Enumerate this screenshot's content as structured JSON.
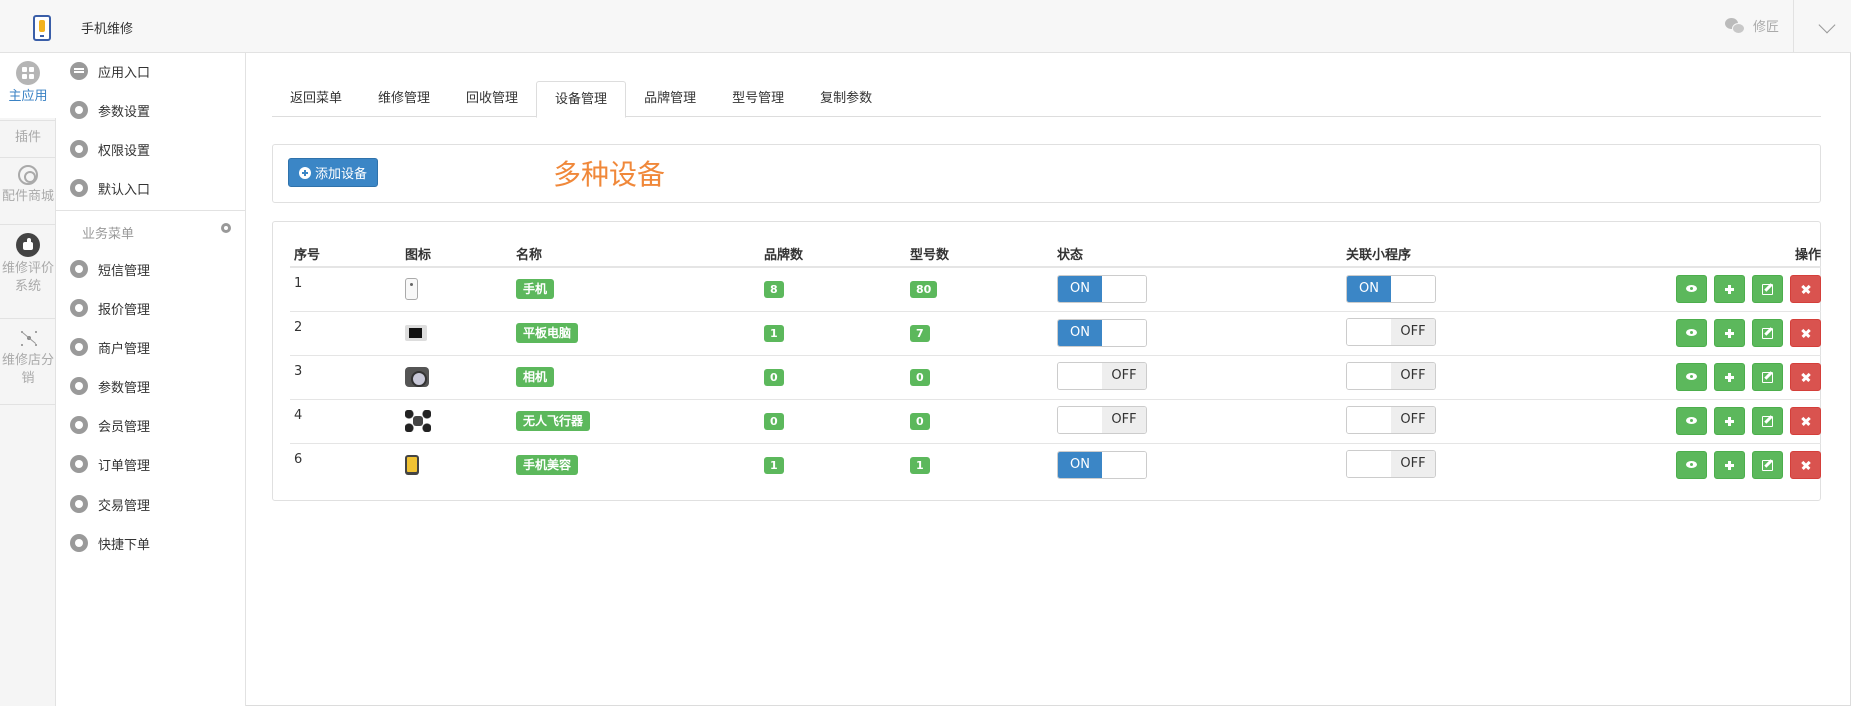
{
  "header": {
    "app_title": "手机维修",
    "user_name": "修匠"
  },
  "rail": {
    "items": [
      {
        "label": "主应用",
        "active": true
      },
      {
        "label": "插件"
      },
      {
        "label": "配件商城"
      },
      {
        "label": "维修评价系统"
      },
      {
        "label": "维修店分销"
      }
    ]
  },
  "menu": {
    "top_items": [
      "应用入口",
      "参数设置",
      "权限设置",
      "默认入口"
    ],
    "group_title": "业务菜单",
    "business_items": [
      "短信管理",
      "报价管理",
      "商户管理",
      "参数管理",
      "会员管理",
      "订单管理",
      "交易管理",
      "快捷下单"
    ]
  },
  "tabs": [
    {
      "label": "返回菜单"
    },
    {
      "label": "维修管理"
    },
    {
      "label": "回收管理"
    },
    {
      "label": "设备管理",
      "active": true
    },
    {
      "label": "品牌管理"
    },
    {
      "label": "型号管理"
    },
    {
      "label": "复制参数"
    }
  ],
  "actions": {
    "add_label": "添加设备",
    "note": "多种设备"
  },
  "table": {
    "columns": [
      "序号",
      "图标",
      "名称",
      "品牌数",
      "型号数",
      "状态",
      "关联小程序",
      "操作"
    ],
    "on_label": "ON",
    "off_label": "OFF",
    "rows": [
      {
        "seq": "1",
        "icon": "phone",
        "name": "手机",
        "brands": "8",
        "models": "80",
        "status": true,
        "miniapp": true
      },
      {
        "seq": "2",
        "icon": "tablet",
        "name": "平板电脑",
        "brands": "1",
        "models": "7",
        "status": true,
        "miniapp": false
      },
      {
        "seq": "3",
        "icon": "camera",
        "name": "相机",
        "brands": "0",
        "models": "0",
        "status": false,
        "miniapp": false
      },
      {
        "seq": "4",
        "icon": "drone",
        "name": "无人飞行器",
        "brands": "0",
        "models": "0",
        "status": false,
        "miniapp": false
      },
      {
        "seq": "6",
        "icon": "beauty",
        "name": "手机美容",
        "brands": "1",
        "models": "1",
        "status": true,
        "miniapp": false
      }
    ]
  },
  "colors": {
    "primary": "#3b86c6",
    "success": "#5cb85c",
    "danger": "#d9534f",
    "note": "#f0883a"
  }
}
